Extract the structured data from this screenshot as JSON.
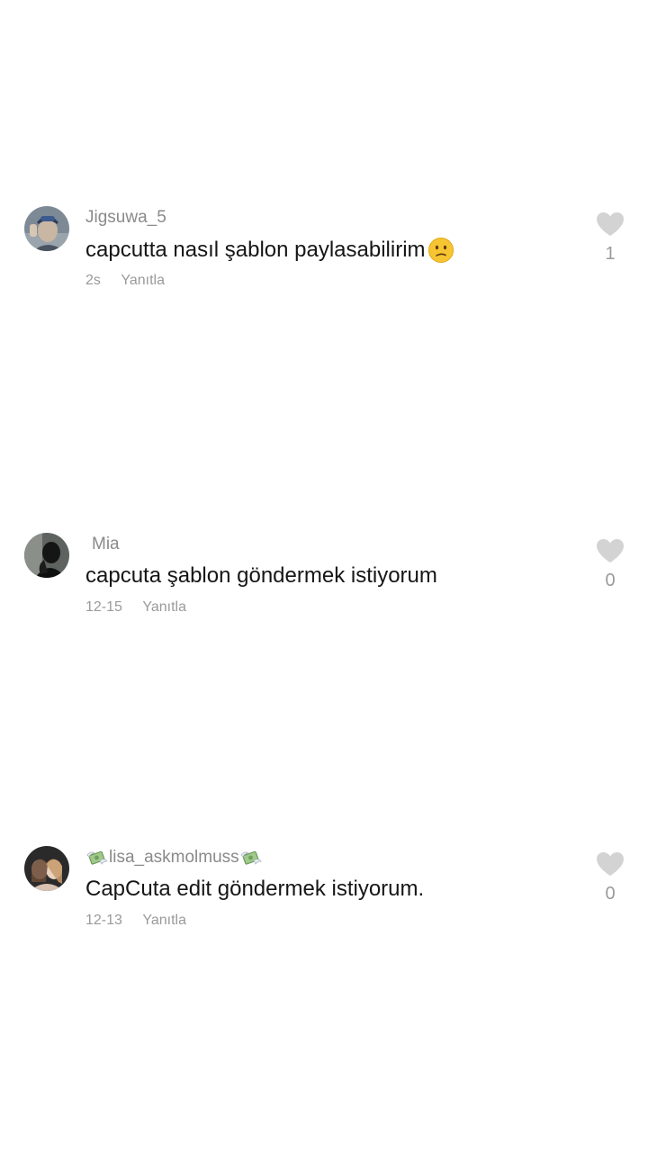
{
  "comments": [
    {
      "username": "Jigsuwa_5",
      "text": "capcutta nasıl şablon paylasabilirim",
      "text_emoji": "confused-face-emoji",
      "time": "2s",
      "reply_label": "Yanıtla",
      "like_count": "1"
    },
    {
      "username": "Mia",
      "text": "capcuta şablon göndermek istiyorum",
      "time": "12-15",
      "reply_label": "Yanıtla",
      "like_count": "0"
    },
    {
      "username": "lisa_askmolmuss",
      "username_emoji": "money-with-wings-emoji",
      "text": "CapCuta edit göndermek istiyorum.",
      "time": "12-13",
      "reply_label": "Yanıtla",
      "like_count": "0"
    }
  ],
  "colors": {
    "background": "#ffffff",
    "username": "#8a8a8a",
    "text": "#161616",
    "meta": "#9a9a9a",
    "heart": "#d3d3d3"
  }
}
